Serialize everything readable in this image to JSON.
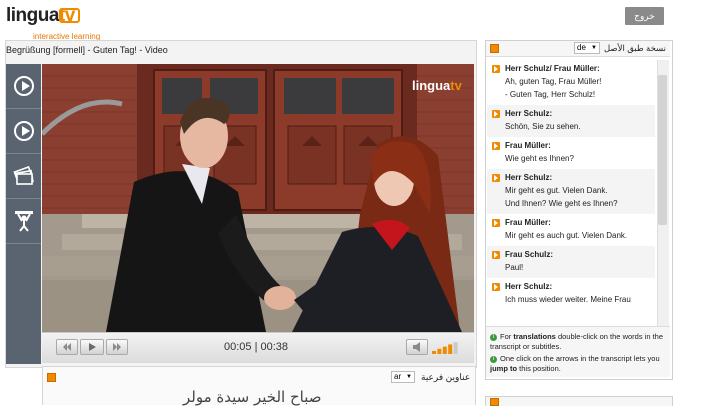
{
  "header": {
    "logo_main": "lingua",
    "logo_tv": "tv",
    "logo_tagline": "interactive learning",
    "exit_label": "خروج"
  },
  "video": {
    "title": "Begrüßung [formell] - Guten Tag! - Video",
    "watermark_main": "lingua",
    "watermark_tv": "tv",
    "time_current": "00:05",
    "time_separator": "|",
    "time_total": "00:38",
    "volume_level": 0.8
  },
  "subtitles": {
    "title": "عناوين فرعية",
    "language": "ar",
    "text": "صباح الخير سيدة مولر"
  },
  "transcript": {
    "title": "نسخة طبق الأصل",
    "language": "de",
    "entries": [
      {
        "speaker": "Herr Schulz/ Frau Müller:",
        "lines": [
          "Ah, guten Tag, Frau Müller!",
          "- Guten Tag, Herr Schulz!"
        ]
      },
      {
        "speaker": "Herr Schulz:",
        "lines": [
          "Schön, Sie zu sehen."
        ]
      },
      {
        "speaker": "Frau Müller:",
        "lines": [
          "Wie geht es Ihnen?"
        ]
      },
      {
        "speaker": "Herr Schulz:",
        "lines": [
          "Mir geht es gut. Vielen Dank.",
          "Und Ihnen? Wie geht es Ihnen?"
        ]
      },
      {
        "speaker": "Frau Müller:",
        "lines": [
          "Mir geht es auch gut. Vielen Dank."
        ]
      },
      {
        "speaker": "Frau Schulz:",
        "lines": [
          "Paul!"
        ]
      },
      {
        "speaker": "Herr Schulz:",
        "lines": [
          "Ich muss wieder weiter. Meine Frau"
        ]
      }
    ],
    "help": {
      "p1_pre": "For ",
      "p1_bold": "translations",
      "p1_post": " double-click on the words in the transcript or subtitles.",
      "p2_pre": "One click on the arrows in the transcript lets you ",
      "p2_bold": "jump to",
      "p2_post": " this position."
    }
  },
  "colors": {
    "accent": "#f08a00",
    "sidebar": "#5a6470",
    "exit_button": "#8a8a8a"
  }
}
